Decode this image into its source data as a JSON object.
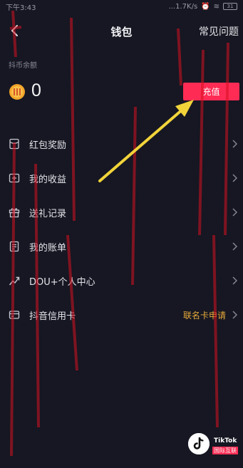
{
  "status_bar": {
    "time": "下午3:43",
    "network": "...1.7K/s",
    "battery": "31"
  },
  "header": {
    "title": "钱包",
    "faq_label": "常见问题",
    "back_icon": "chevron-left-icon"
  },
  "balance": {
    "label": "抖币余额",
    "value": "0",
    "coin_icon": "coin-icon",
    "recharge_label": "充值"
  },
  "menu": [
    {
      "label": "红包奖励",
      "icon": "red-packet-icon"
    },
    {
      "label": "我的收益",
      "icon": "income-icon"
    },
    {
      "label": "送礼记录",
      "icon": "gift-icon"
    },
    {
      "label": "我的账单",
      "icon": "bill-icon"
    },
    {
      "label": "DOU+个人中心",
      "icon": "trend-icon"
    },
    {
      "label": "抖音信用卡",
      "icon": "credit-card-icon",
      "extra": "联名卡申请"
    }
  ],
  "watermark": {
    "brand": "TikTok",
    "sub": "国际互联"
  },
  "colors": {
    "background": "#161722",
    "accent": "#fe2c55",
    "highlight": "#e6a93a",
    "annotation_arrow": "#f2d43a"
  }
}
